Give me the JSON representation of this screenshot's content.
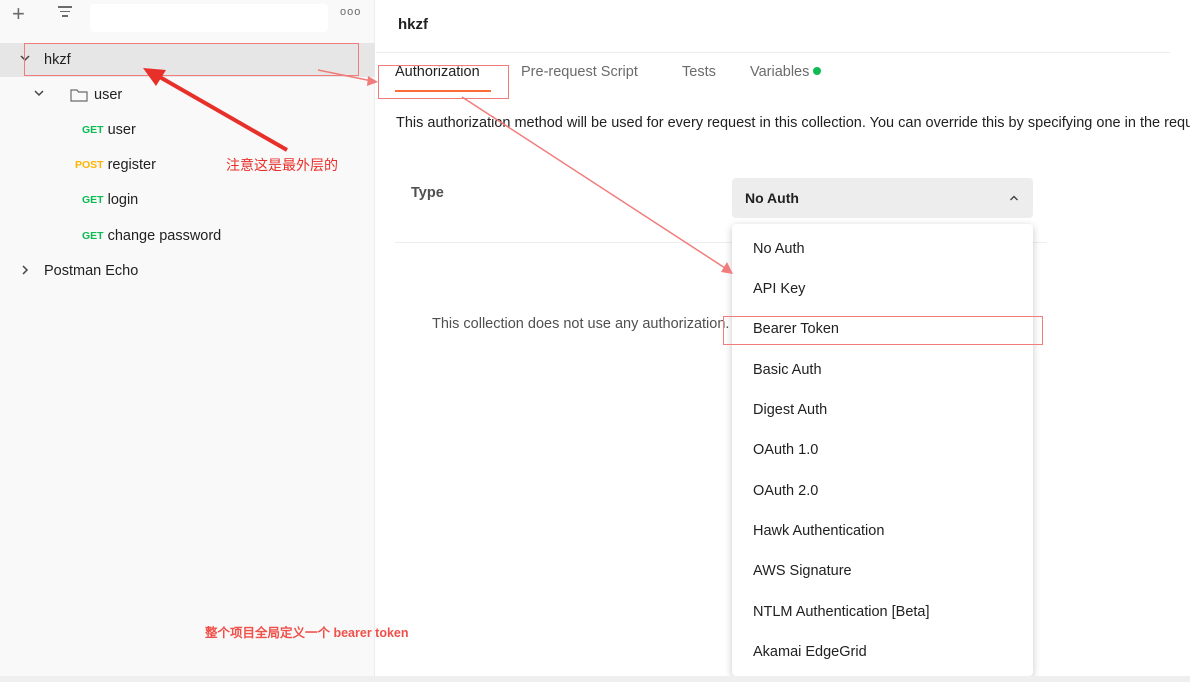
{
  "sidebar": {
    "more_label": "ooo",
    "tree": [
      {
        "label": "hkzf",
        "level": 0,
        "expanded": true,
        "active": true
      },
      {
        "label": "user",
        "level": 1,
        "type": "folder",
        "expanded": true
      },
      {
        "method": "GET",
        "label": "user",
        "level": 2
      },
      {
        "method": "POST",
        "label": "register",
        "level": 2
      },
      {
        "method": "GET",
        "label": "login",
        "level": 2
      },
      {
        "method": "GET",
        "label": "change password",
        "level": 2
      },
      {
        "label": "Postman Echo",
        "level": 0,
        "expanded": false
      }
    ]
  },
  "main": {
    "title": "hkzf",
    "tabs": [
      "Authorization",
      "Pre-request Script",
      "Tests",
      "Variables"
    ],
    "active_tab": "Authorization",
    "description": "This authorization method will be used for every request in this collection. You can override this by specifying one in the request.",
    "type_label": "Type",
    "selected_auth": "No Auth",
    "no_auth_message": "This collection does not use any authorization.",
    "auth_options": [
      "No Auth",
      "API Key",
      "Bearer Token",
      "Basic Auth",
      "Digest Auth",
      "OAuth 1.0",
      "OAuth 2.0",
      "Hawk Authentication",
      "AWS Signature",
      "NTLM Authentication [Beta]",
      "Akamai EdgeGrid"
    ]
  },
  "annotations": {
    "outermost_note": "注意这是最外层的",
    "global_note": "整个项目全局定义一个 bearer token"
  },
  "colors": {
    "accent": "#ff6c37",
    "get": "#0cbb52",
    "post": "#ffb400",
    "annotation": "#e8302a"
  }
}
